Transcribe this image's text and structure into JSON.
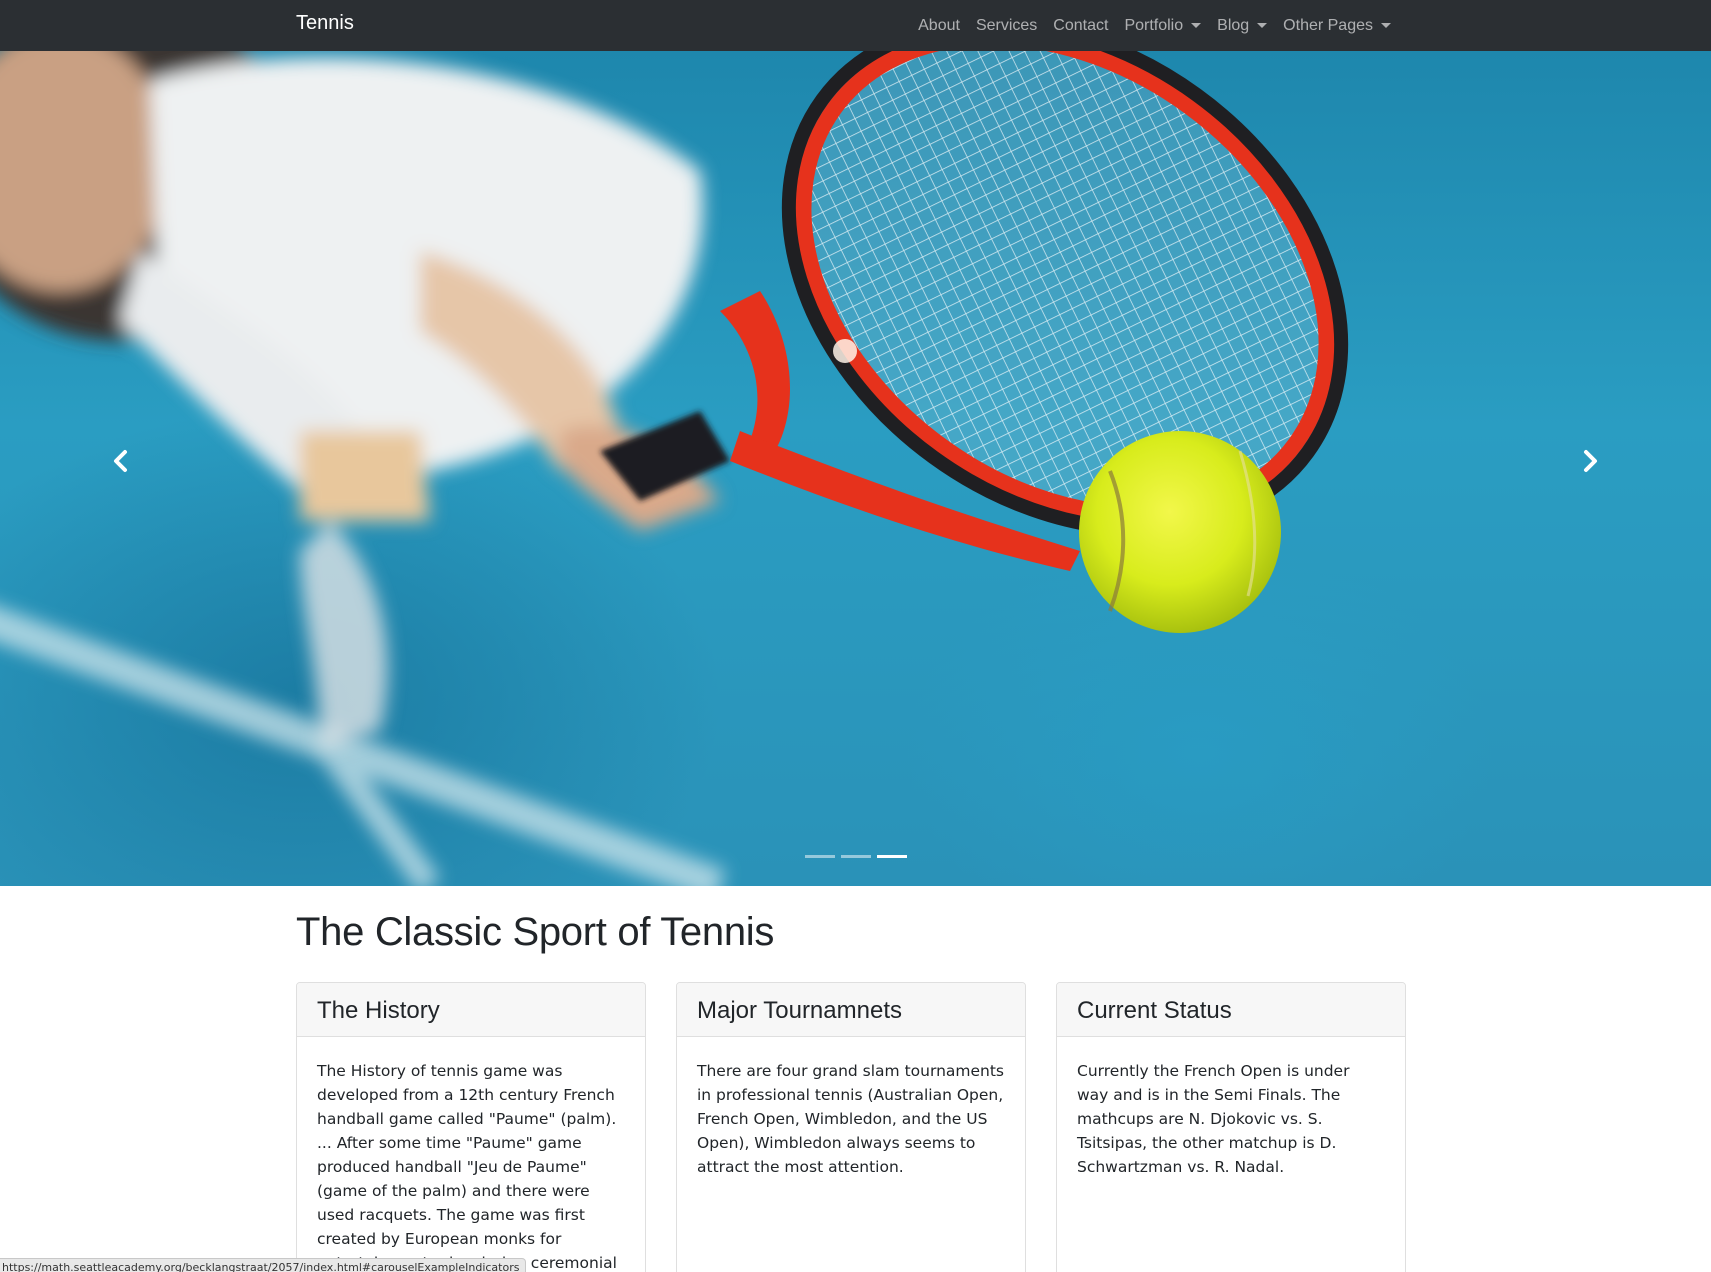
{
  "navbar": {
    "brand": "Tennis",
    "items": [
      {
        "label": "About",
        "dropdown": false
      },
      {
        "label": "Services",
        "dropdown": false
      },
      {
        "label": "Contact",
        "dropdown": false
      },
      {
        "label": "Portfolio",
        "dropdown": true
      },
      {
        "label": "Blog",
        "dropdown": true
      },
      {
        "label": "Other Pages",
        "dropdown": true
      }
    ]
  },
  "carousel": {
    "prev_icon": "chevron-left-icon",
    "next_icon": "chevron-right-icon",
    "indicator_count": 3,
    "active_indicator": 3
  },
  "main": {
    "heading": "The Classic Sport of Tennis",
    "cards": [
      {
        "title": "The History",
        "body": "The History of tennis game was developed from a 12th century French handball game called \"Paume\" (palm). ... After some time \"Paume\" game produced handball \"Jeu de Paume\" (game of the palm) and there were used racquets. The game was first created by European monks for entertainment roles during ceremonial occasions."
      },
      {
        "title": "Major Tournamnets",
        "body": "There are four grand slam tournaments in professional tennis (Australian Open, French Open, Wimbledon, and the US Open), Wimbledon always seems to attract the most attention."
      },
      {
        "title": "Current Status",
        "body": "Currently the French Open is under way and is in the Semi Finals. The mathcups are N. Djokovic vs. S. Tsitsipas, the other matchup is D. Schwartzman vs. R. Nadal."
      }
    ]
  },
  "statusbar": {
    "url": "https://math.seattleacademy.org/becklangstraat/2057/index.html#carouselExampleIndicators"
  },
  "colors": {
    "navbar_bg": "#2b2f33",
    "carousel_blue": "#2a9dc2",
    "ball": "#d8ec1c",
    "racket_frame": "#e6321c"
  }
}
